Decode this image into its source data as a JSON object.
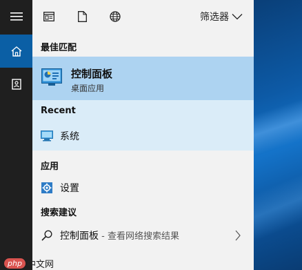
{
  "rail": {
    "items": [
      "menu",
      "home",
      "notebook"
    ]
  },
  "toolbar": {
    "filter_label": "筛选器"
  },
  "best_match": {
    "header": "最佳匹配",
    "title": "控制面板",
    "subtitle": "桌面应用"
  },
  "recent": {
    "header": "Recent",
    "items": [
      {
        "label": "系统"
      }
    ]
  },
  "apps": {
    "header": "应用",
    "items": [
      {
        "label": "设置"
      }
    ]
  },
  "suggestions": {
    "header": "搜索建议",
    "query": "控制面板",
    "separator": " - ",
    "hint": "查看网络搜索结果"
  },
  "watermark": {
    "logo": "php",
    "text": "中文网"
  },
  "colors": {
    "rail_bg": "#1f1f1f",
    "rail_active": "#0b5fa5",
    "panel_bg": "#f2f2f2",
    "best_match_bg": "#add3f1",
    "recent_bg": "#daecf8",
    "accent": "#0b5fa5"
  }
}
